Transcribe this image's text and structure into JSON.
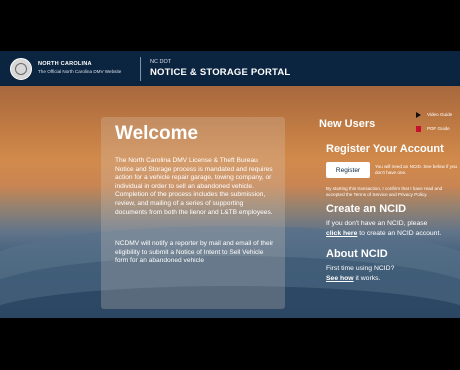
{
  "header": {
    "state": "NORTH CAROLINA",
    "state_subtitle": "The Official North Carolina DMV Website",
    "agency": "NC DOT",
    "portal_title": "NOTICE & STORAGE PORTAL"
  },
  "welcome": {
    "title": "Welcome",
    "paragraph1": "The North Carolina DMV License & Theft Bureau Notice and Storage process is mandated and requires action for a vehicle repair garage, towing company, or individual in order to sell an abandoned vehicle. Completion of the process includes the submission, review, and mailing of a series of supporting documents from both the lienor and L&TB employees.",
    "paragraph2": "NCDMV will notify a reporter by mail and email of their eligibility to submit a Notice of Intent to Sell Vehicle form for an abandoned vehicle"
  },
  "sidebar": {
    "new_users": "New Users",
    "video_guide": "Video Guide",
    "pdf_guide": "PDF Guide",
    "register_title": "Register Your Account",
    "register_button": "Register",
    "register_note": "You will need an NCID. See below if you don't have one.",
    "consent": "By starting this transaction, I confirm that I have read and accepted the Terms of Service and Privacy Policy.",
    "create_title": "Create an NCID",
    "create_pre": "If you don't have an NCID, please",
    "create_link": "click here",
    "create_post": " to create an NCID account.",
    "about_title": "About NCID",
    "about_line": "First time using NCID?",
    "about_link": "See how",
    "about_post": " it works."
  },
  "icons": {
    "video": "play-icon",
    "pdf": "pdf-icon",
    "seal": "state-seal-icon"
  },
  "colors": {
    "header_bg": "#0b2440",
    "pdf_red": "#c8102e"
  }
}
